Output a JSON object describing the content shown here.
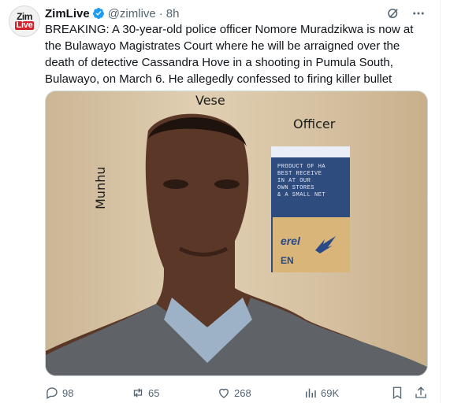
{
  "account": {
    "name": "ZimLive",
    "handle": "@zimlive",
    "separator": "·",
    "time": "8h",
    "avatar": {
      "top": "Zim",
      "bottom": "Live"
    }
  },
  "tweet": {
    "text": "BREAKING: A 30-year-old police officer Nomore Muradzikwa is now at the Bulawayo Magistrates Court where he will be arraigned over the death of detective Cassandra Hove in a shooting in Pumula South, Bulawayo, on March 6. He allegedly confessed to firing killer bullet"
  },
  "media": {
    "captions": {
      "vese": "Vese",
      "officer": "Officer",
      "munhu": "Munhu"
    },
    "board": {
      "text": "PRODUCT OF HA\nBEST RECEIVE\nIN AT OUR\nOWN STORES\n& A SMALL NET",
      "card_brand": "erel",
      "card_sub": "EN"
    }
  },
  "stats": {
    "replies": "98",
    "reposts": "65",
    "likes": "268",
    "views": "69K"
  },
  "colors": {
    "verified": "#1d9bf0",
    "muted": "#536471",
    "text": "#0f1419",
    "avatar_red": "#d4202a"
  },
  "icons": {
    "verified": "verified-badge-icon",
    "grok": "grok-icon",
    "more": "more-icon",
    "reply": "reply-icon",
    "repost": "repost-icon",
    "like": "like-icon",
    "views": "views-icon",
    "bookmark": "bookmark-icon",
    "share": "share-icon"
  }
}
